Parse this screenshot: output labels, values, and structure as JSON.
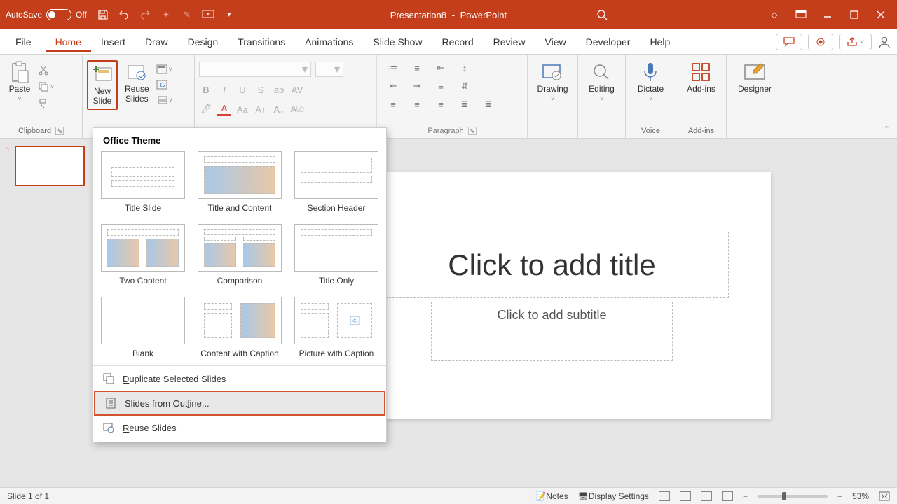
{
  "titlebar": {
    "autosave_label": "AutoSave",
    "autosave_state": "Off",
    "doc_name": "Presentation8",
    "app_name": "PowerPoint"
  },
  "tabs": {
    "file": "File",
    "list": [
      "Home",
      "Insert",
      "Draw",
      "Design",
      "Transitions",
      "Animations",
      "Slide Show",
      "Record",
      "Review",
      "View",
      "Developer",
      "Help"
    ],
    "active": "Home"
  },
  "ribbon": {
    "clipboard": {
      "paste": "Paste",
      "group": "Clipboard"
    },
    "slides": {
      "new_slide": "New\nSlide",
      "reuse": "Reuse\nSlides"
    },
    "paragraph": {
      "group": "Paragraph"
    },
    "drawing": "Drawing",
    "editing": "Editing",
    "dictate": "Dictate",
    "voice_group": "Voice",
    "addins": "Add-ins",
    "addins_group": "Add-ins",
    "designer": "Designer"
  },
  "dropdown": {
    "header": "Office Theme",
    "layouts": [
      "Title Slide",
      "Title and Content",
      "Section Header",
      "Two Content",
      "Comparison",
      "Title Only",
      "Blank",
      "Content with Caption",
      "Picture with Caption"
    ],
    "duplicate": "Duplicate Selected Slides",
    "outline": "Slides from Outline...",
    "reuse": "Reuse Slides"
  },
  "canvas": {
    "title_placeholder": "Click to add title",
    "subtitle_placeholder": "Click to add subtitle"
  },
  "nav": {
    "slide_number": "1"
  },
  "status": {
    "slide_info": "Slide 1 of 1",
    "notes": "Notes",
    "display": "Display Settings",
    "zoom": "53%"
  }
}
